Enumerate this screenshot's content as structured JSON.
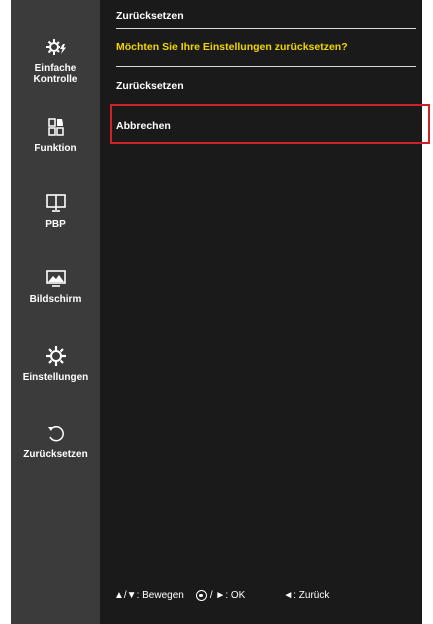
{
  "sidebar": {
    "items": [
      {
        "label": "Einfache\nKontrolle",
        "icon": "gear-lightning-icon"
      },
      {
        "label": "Funktion",
        "icon": "function-grid-icon"
      },
      {
        "label": "PBP",
        "icon": "pbp-monitor-icon"
      },
      {
        "label": "Bildschirm",
        "icon": "picture-icon"
      },
      {
        "label": "Einstellungen",
        "icon": "gear-icon"
      },
      {
        "label": "Zurücksetzen",
        "icon": "reset-icon"
      }
    ]
  },
  "main": {
    "title": "Zurücksetzen",
    "question": "Möchten Sie Ihre Einstellungen zurücksetzen?",
    "options": [
      "Zurücksetzen",
      "Abbrechen"
    ],
    "selected_option": "Abbrechen"
  },
  "footer": {
    "move_label": ": Bewegen",
    "move_arrows": "▲/▼",
    "ok_label": ": OK",
    "ok_sep": "/ ►",
    "back_arrow": "◄",
    "back_label": ": Zurück"
  },
  "colors": {
    "sidebar_bg": "#3b3b3b",
    "panel_bg": "#1a1a1a",
    "question_text": "#f2d600",
    "selection_border": "#d0202a"
  }
}
